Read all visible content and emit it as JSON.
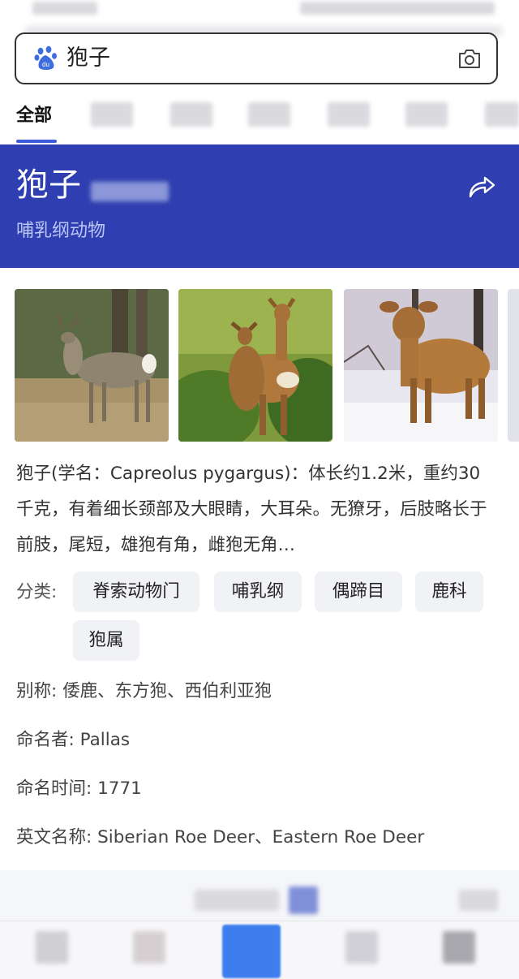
{
  "search": {
    "query": "狍子"
  },
  "tabs": {
    "active_label": "全部"
  },
  "entity": {
    "title": "狍子",
    "subtitle": "哺乳纲动物"
  },
  "description": "狍子(学名：Capreolus pygargus)：体长约1.2米，重约30千克，有着细长颈部及大眼睛，大耳朵。无獠牙，后肢略长于前肢，尾短，雄狍有角，雌狍无角…",
  "classification": {
    "label": "分类:",
    "chips": [
      "脊索动物门",
      "哺乳纲",
      "偶蹄目",
      "鹿科",
      "狍属"
    ]
  },
  "info": [
    {
      "label": "别称:",
      "value": "倭鹿、东方狍、西伯利亚狍"
    },
    {
      "label": "命名者:",
      "value": "Pallas"
    },
    {
      "label": "命名时间:",
      "value": "1771"
    },
    {
      "label": "英文名称:",
      "value": "Siberian Roe Deer、Eastern Roe Deer"
    }
  ],
  "colors": {
    "banner": "#2f3fb1",
    "accent": "#3b5bdb",
    "chip_bg": "#f1f2f5"
  },
  "icons": [
    "baidu-paw-icon",
    "camera-icon",
    "share-icon"
  ]
}
